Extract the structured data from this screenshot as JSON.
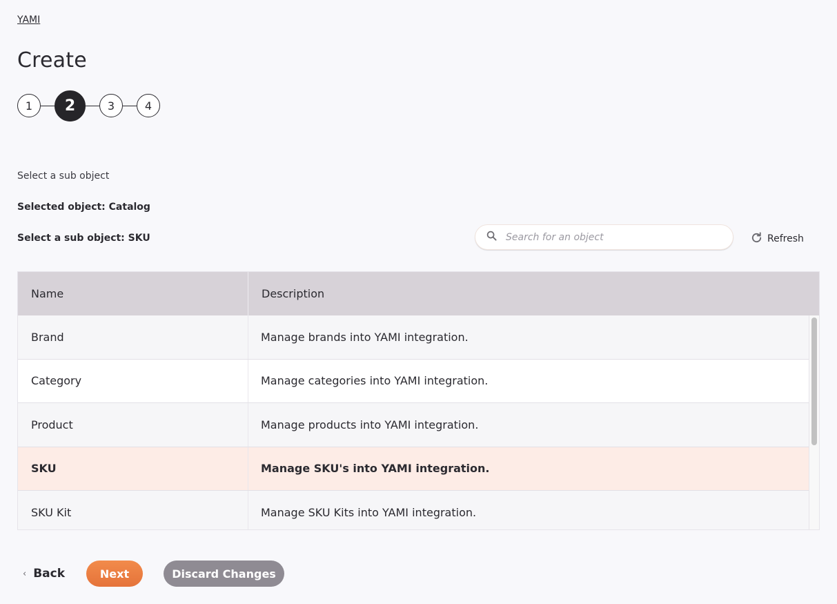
{
  "breadcrumb": "YAMI",
  "page_title": "Create",
  "stepper": {
    "steps": [
      "1",
      "2",
      "3",
      "4"
    ],
    "active_step": 2
  },
  "section_label": "Select a sub object",
  "selected_object": "Selected object: Catalog",
  "selected_sub_object": "Select a sub object: SKU",
  "search": {
    "placeholder": "Search for an object",
    "value": "",
    "icon": "search-icon"
  },
  "refresh": {
    "label": "Refresh",
    "icon": "refresh-icon"
  },
  "table": {
    "columns": [
      "Name",
      "Description"
    ],
    "rows": [
      {
        "name": "Brand",
        "description": "Manage brands into YAMI integration.",
        "selected": false
      },
      {
        "name": "Category",
        "description": "Manage categories into YAMI integration.",
        "selected": false
      },
      {
        "name": "Product",
        "description": "Manage products into YAMI integration.",
        "selected": false
      },
      {
        "name": "SKU",
        "description": "Manage SKU's into YAMI integration.",
        "selected": true
      },
      {
        "name": "SKU Kit",
        "description": "Manage SKU Kits into YAMI integration.",
        "selected": false
      }
    ],
    "selected_row_color": "#fdece6"
  },
  "footer": {
    "back_label": "Back",
    "next_label": "Next",
    "discard_label": "Discard Changes"
  },
  "colors": {
    "accent": "#ee7d43",
    "discard": "#8f8b93",
    "header_bg": "#d7d2d8",
    "active_step": "#262529"
  }
}
